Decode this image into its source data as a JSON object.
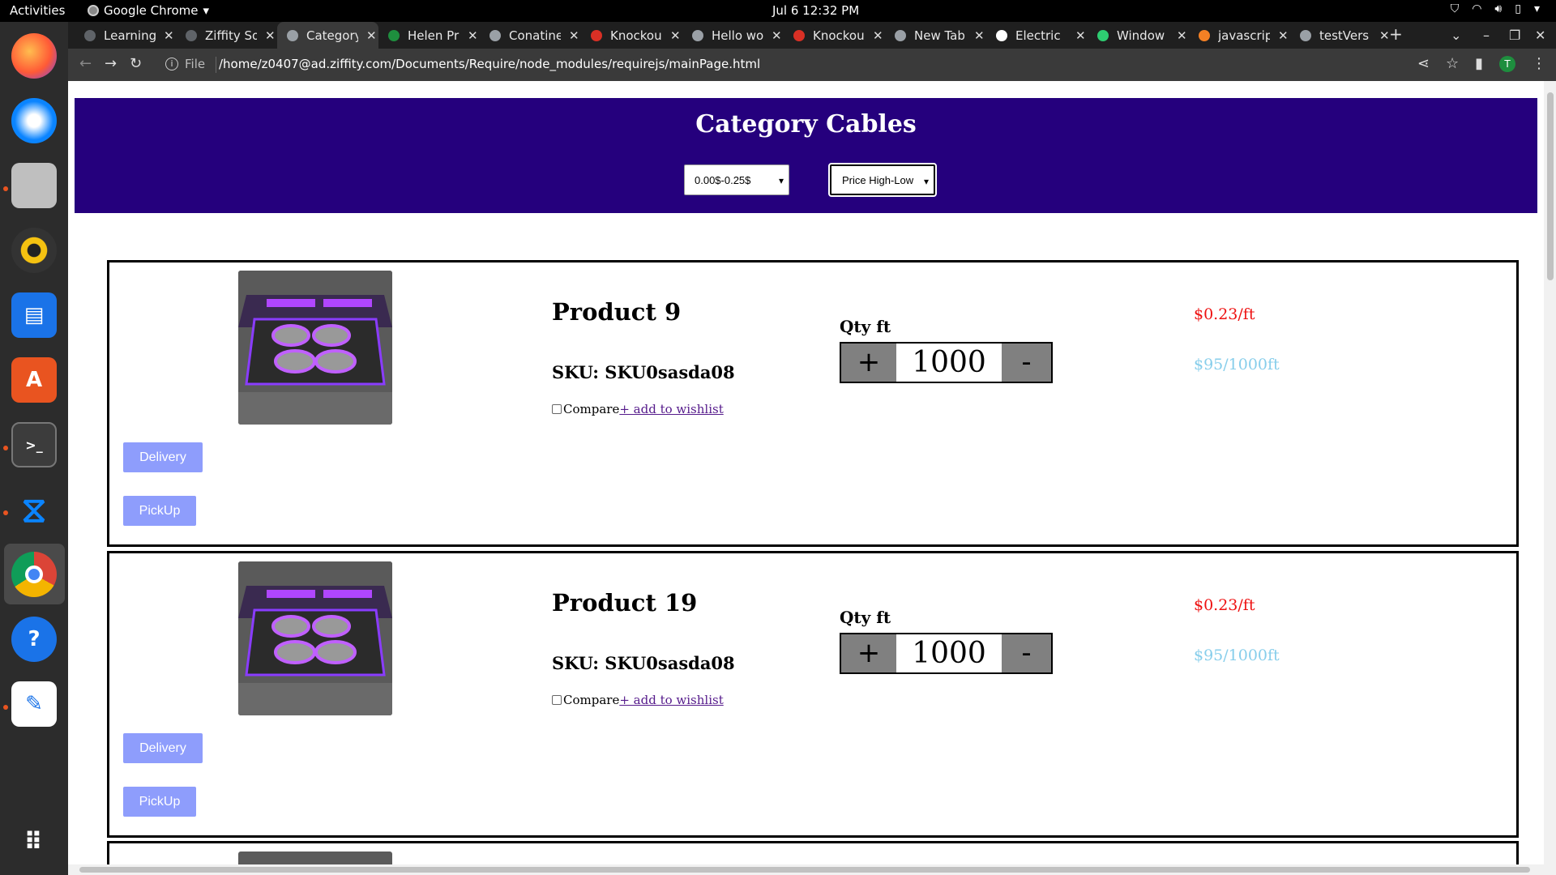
{
  "system": {
    "activities": "Activities",
    "app_name": "Google Chrome",
    "clock": "Jul 6  12:32 PM"
  },
  "tabs": [
    {
      "label": "Learning",
      "icon_color": "#5f6368"
    },
    {
      "label": "Ziffity So",
      "icon_color": "#5f6368"
    },
    {
      "label": "Category",
      "icon_color": "#9aa0a6",
      "active": true
    },
    {
      "label": "Helen Pr",
      "icon_color": "#1e8e3e"
    },
    {
      "label": "Conatine",
      "icon_color": "#9aa0a6"
    },
    {
      "label": "Knockou",
      "icon_color": "#d93025"
    },
    {
      "label": "Hello wo",
      "icon_color": "#9aa0a6"
    },
    {
      "label": "Knockou",
      "icon_color": "#d93025"
    },
    {
      "label": "New Tab",
      "icon_color": "#9aa0a6"
    },
    {
      "label": "Electric",
      "icon_color": "#ffffff"
    },
    {
      "label": "Window",
      "icon_color": "#2ecc71"
    },
    {
      "label": "javascrip",
      "icon_color": "#f48024"
    },
    {
      "label": "testVers",
      "icon_color": "#9aa0a6"
    }
  ],
  "toolbar": {
    "file_label": "File",
    "url": "/home/z0407@ad.ziffity.com/Documents/Require/node_modules/requirejs/mainPage.html",
    "profile_initial": "T"
  },
  "page": {
    "title": "Category Cables",
    "price_filter": "0.00$-0.25$",
    "sort": "Price High-Low"
  },
  "products": [
    {
      "name": "Product 9",
      "sku": "SKU: SKU0sasda08",
      "compare": "Compare",
      "wishlist": "+ add to wishlist",
      "qty_label": "Qty ft",
      "qty": "1000",
      "price": "$0.23/ft",
      "bulk_price": "$95/1000ft",
      "delivery": "Delivery",
      "pickup": "PickUp"
    },
    {
      "name": "Product 19",
      "sku": "SKU: SKU0sasda08",
      "compare": "Compare",
      "wishlist": "+ add to wishlist",
      "qty_label": "Qty ft",
      "qty": "1000",
      "price": "$0.23/ft",
      "bulk_price": "$95/1000ft",
      "delivery": "Delivery",
      "pickup": "PickUp"
    }
  ],
  "colors": {
    "header_bg": "#25007d",
    "price": "#ee1111",
    "bulk_price": "#87ceeb",
    "button_bg": "#8e9dfc",
    "wishlist_link": "#551a8b"
  }
}
